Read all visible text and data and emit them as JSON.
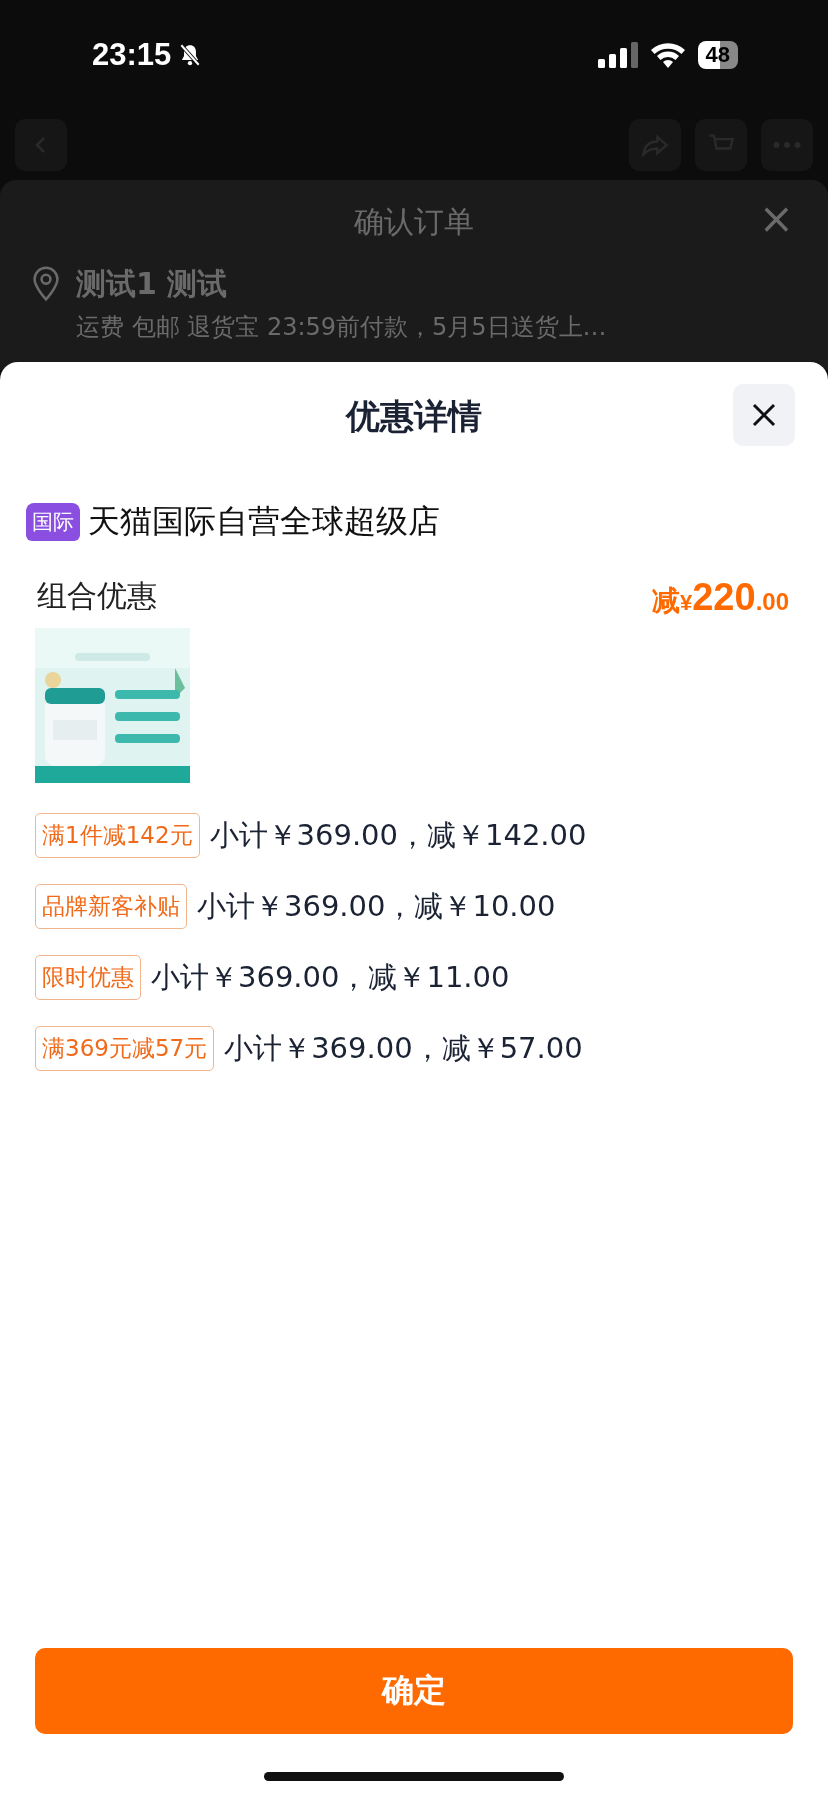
{
  "status_bar": {
    "time": "23:15",
    "silent": true,
    "battery": "48"
  },
  "background_sheet": {
    "title": "确认订单",
    "close": "×",
    "address_name": "测试1 测试",
    "address_detail": "运费 包邮 退货宝 23:59前付款，5月5日送货上…"
  },
  "sheet": {
    "title": "优惠详情",
    "store": {
      "badge": "国际",
      "name": "天猫国际自营全球超级店"
    },
    "group": {
      "label": "组合优惠",
      "amount": {
        "prefix": "减",
        "currency": "¥",
        "integer": "220",
        "decimal": ".00"
      }
    },
    "discounts": [
      {
        "tag": "满1件减142元",
        "detail": "小计￥369.00，减￥142.00"
      },
      {
        "tag": "品牌新客补贴",
        "detail": "小计￥369.00，减￥10.00"
      },
      {
        "tag": "限时优惠",
        "detail": "小计￥369.00，减￥11.00"
      },
      {
        "tag": "满369元减57元",
        "detail": "小计￥369.00，减￥57.00"
      }
    ],
    "confirm": "确定"
  }
}
